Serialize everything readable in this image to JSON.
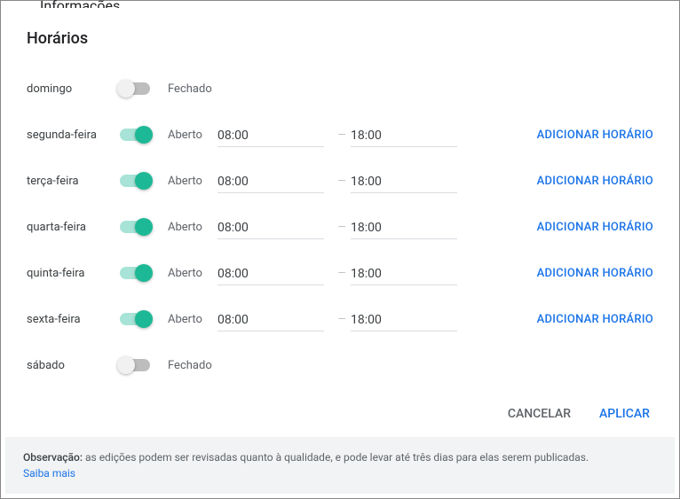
{
  "behind": "Informações",
  "title": "Horários",
  "status_open": "Aberto",
  "status_closed": "Fechado",
  "add_hours_label": "ADICIONAR HORÁRIO",
  "dash": "—",
  "days": [
    {
      "name": "domingo",
      "open": false
    },
    {
      "name": "segunda-feira",
      "open": true,
      "from": "08:00",
      "to": "18:00"
    },
    {
      "name": "terça-feira",
      "open": true,
      "from": "08:00",
      "to": "18:00"
    },
    {
      "name": "quarta-feira",
      "open": true,
      "from": "08:00",
      "to": "18:00"
    },
    {
      "name": "quinta-feira",
      "open": true,
      "from": "08:00",
      "to": "18:00"
    },
    {
      "name": "sexta-feira",
      "open": true,
      "from": "08:00",
      "to": "18:00"
    },
    {
      "name": "sábado",
      "open": false
    }
  ],
  "actions": {
    "cancel": "CANCELAR",
    "apply": "APLICAR"
  },
  "footer": {
    "prefix": "Observação:",
    "text": " as edições podem ser revisadas quanto à qualidade, e pode levar até três dias para elas serem publicadas.",
    "learn_more": "Saiba mais"
  }
}
